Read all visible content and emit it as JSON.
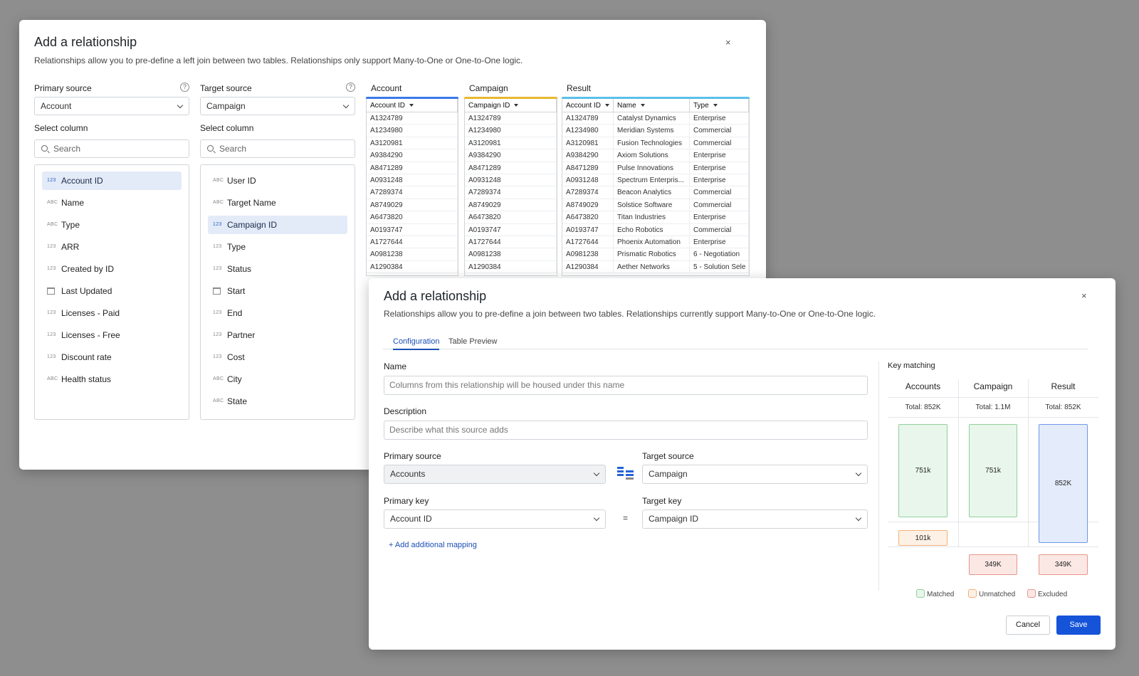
{
  "back_dialog": {
    "title": "Add a relationship",
    "description": "Relationships allow you to pre-define a left join between two tables. Relationships only support Many-to-One or One-to-One logic.",
    "close_glyph": "×",
    "primary_source": {
      "label": "Primary source",
      "value": "Account"
    },
    "target_source": {
      "label": "Target source",
      "value": "Campaign"
    },
    "help_glyph": "?",
    "select_column_label": "Select column",
    "search_placeholder": "Search",
    "primary_columns": [
      {
        "type": "123",
        "label": "Account ID",
        "selected": true
      },
      {
        "type": "ABC",
        "label": "Name"
      },
      {
        "type": "ABC",
        "label": "Type"
      },
      {
        "type": "123",
        "label": "ARR"
      },
      {
        "type": "123",
        "label": "Created by ID"
      },
      {
        "type": "cal",
        "label": "Last Updated"
      },
      {
        "type": "123",
        "label": "Licenses - Paid"
      },
      {
        "type": "123",
        "label": "Licenses - Free"
      },
      {
        "type": "123",
        "label": "Discount rate"
      },
      {
        "type": "ABC",
        "label": "Health status"
      }
    ],
    "target_columns": [
      {
        "type": "ABC",
        "label": "User ID"
      },
      {
        "type": "ABC",
        "label": "Target Name"
      },
      {
        "type": "123",
        "label": "Campaign ID",
        "selected": true
      },
      {
        "type": "123",
        "label": "Type"
      },
      {
        "type": "123",
        "label": "Status"
      },
      {
        "type": "cal",
        "label": "Start"
      },
      {
        "type": "123",
        "label": "End"
      },
      {
        "type": "123",
        "label": "Partner"
      },
      {
        "type": "123",
        "label": "Cost"
      },
      {
        "type": "ABC",
        "label": "City"
      },
      {
        "type": "ABC",
        "label": "State"
      }
    ],
    "account_table": {
      "title": "Account",
      "color": "#3b78e7",
      "header": "Account ID",
      "rows": [
        "A1324789",
        "A1234980",
        "A3120981",
        "A9384290",
        "A8471289",
        "A0931248",
        "A7289374",
        "A8749029",
        "A6473820",
        "A0193747",
        "A1727644",
        "A0981238",
        "A1290384"
      ]
    },
    "campaign_table": {
      "title": "Campaign",
      "color": "#e8b830",
      "header": "Campaign ID",
      "rows": [
        "A1324789",
        "A1234980",
        "A3120981",
        "A9384290",
        "A8471289",
        "A0931248",
        "A7289374",
        "A8749029",
        "A6473820",
        "A0193747",
        "A1727644",
        "A0981238",
        "A1290384"
      ]
    },
    "result_table": {
      "title": "Result",
      "color": "#5bc0ea",
      "headers": [
        "Account ID",
        "Name",
        "Type"
      ],
      "rows": [
        [
          "A1324789",
          "Catalyst Dynamics",
          "Enterprise"
        ],
        [
          "A1234980",
          "Meridian Systems",
          "Commercial"
        ],
        [
          "A3120981",
          "Fusion Technologies",
          "Commercial"
        ],
        [
          "A9384290",
          "Axiom Solutions",
          "Enterprise"
        ],
        [
          "A8471289",
          "Pulse Innovations",
          "Enterprise"
        ],
        [
          "A0931248",
          "Spectrum Enterpris...",
          "Enterprise"
        ],
        [
          "A7289374",
          "Beacon Analytics",
          "Commercial"
        ],
        [
          "A8749029",
          "Solstice Software",
          "Commercial"
        ],
        [
          "A6473820",
          "Titan Industries",
          "Enterprise"
        ],
        [
          "A0193747",
          "Echo Robotics",
          "Commercial"
        ],
        [
          "A1727644",
          "Phoenix Automation",
          "Enterprise"
        ],
        [
          "A0981238",
          "Prismatic Robotics",
          "6 - Negotiation"
        ],
        [
          "A1290384",
          "Aether Networks",
          "5 - Solution Sele"
        ]
      ]
    }
  },
  "front_dialog": {
    "title": "Add a relationship",
    "description": "Relationships allow you to pre-define a join between two tables. Relationships currently support Many-to-One or One-to-One logic.",
    "close_glyph": "×",
    "tabs": [
      {
        "label": "Configuration",
        "active": true
      },
      {
        "label": "Table Preview"
      }
    ],
    "name": {
      "label": "Name",
      "placeholder": "Columns from this relationship will be housed under this name"
    },
    "description_field": {
      "label": "Description",
      "placeholder": "Describe what this source adds"
    },
    "primary_source": {
      "label": "Primary source",
      "value": "Accounts"
    },
    "target_source": {
      "label": "Target source",
      "value": "Campaign"
    },
    "primary_key": {
      "label": "Primary key",
      "value": "Account ID"
    },
    "target_key": {
      "label": "Target key",
      "value": "Campaign ID"
    },
    "equals_glyph": "=",
    "add_mapping": "+ Add additional mapping",
    "key_matching": {
      "title": "Key matching",
      "columns": [
        {
          "head": "Accounts",
          "total": "Total: 852K",
          "matched": "751k",
          "unmatched": "101k"
        },
        {
          "head": "Campaign",
          "total": "Total: 1.1M",
          "matched": "751k",
          "excluded": "349K"
        },
        {
          "head": "Result",
          "total": "Total: 852K",
          "result": "852K",
          "excluded": "349K"
        }
      ],
      "legend": [
        {
          "label": "Matched",
          "color": "#8fd19b"
        },
        {
          "label": "Unmatched",
          "color": "#f0b07a"
        },
        {
          "label": "Excluded",
          "color": "#e8958a"
        }
      ]
    },
    "buttons": {
      "cancel": "Cancel",
      "save": "Save"
    },
    "colors": {
      "primary": "#1553d8",
      "link": "#1b4fb5"
    }
  }
}
